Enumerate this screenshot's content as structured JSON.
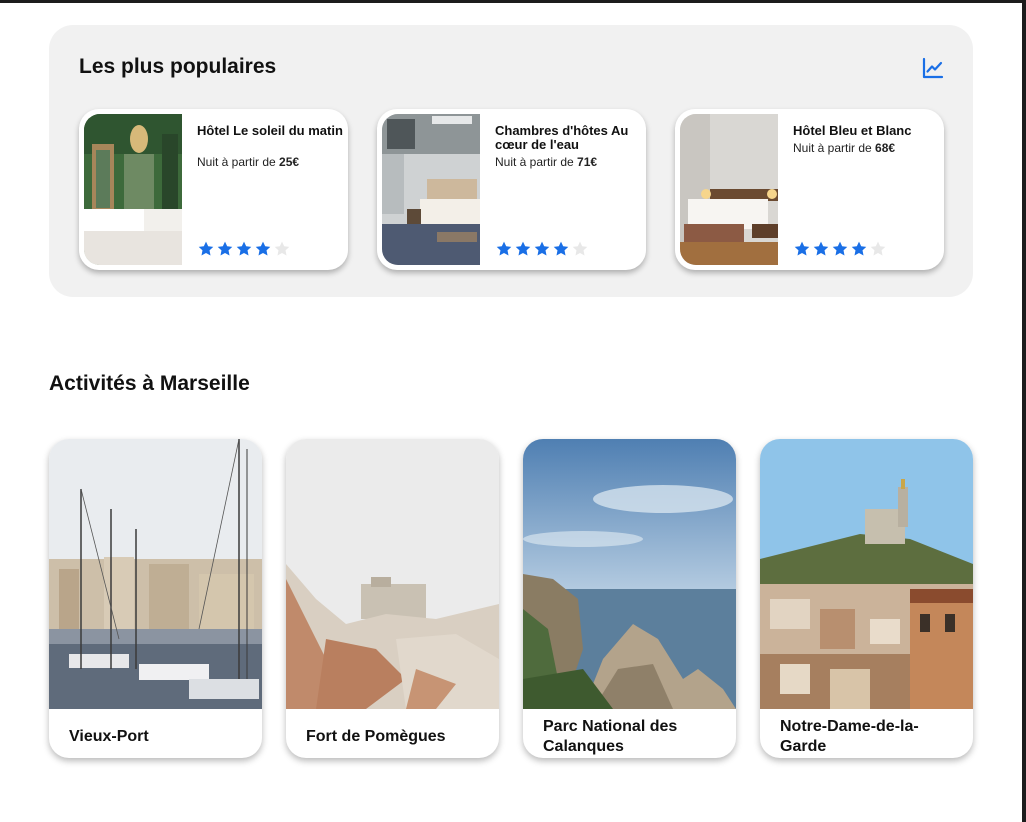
{
  "popular": {
    "title": "Les plus populaires",
    "icon": "trend-chart-icon",
    "accent_color": "#1a6fe6",
    "hotels": [
      {
        "name": "Hôtel Le soleil du matin",
        "price_prefix": "Nuit à partir de ",
        "price": "25€",
        "rating": 4,
        "max_rating": 5
      },
      {
        "name": "Chambres d'hôtes Au cœur de l'eau",
        "price_prefix": "Nuit à partir de ",
        "price": "71€",
        "rating": 4,
        "max_rating": 5
      },
      {
        "name": "Hôtel Bleu et Blanc",
        "price_prefix": "Nuit à partir de ",
        "price": "68€",
        "rating": 4,
        "max_rating": 5
      }
    ]
  },
  "activities": {
    "title": "Activités à Marseille",
    "items": [
      {
        "name": "Vieux-Port"
      },
      {
        "name": "Fort de Pomègues"
      },
      {
        "name": "Parc National des Calanques"
      },
      {
        "name": "Notre-Dame-de-la-Garde"
      }
    ]
  },
  "colors": {
    "star_filled": "#1a6fe6",
    "star_empty": "#e8e8e8",
    "section_bg": "#f1f1f1"
  }
}
